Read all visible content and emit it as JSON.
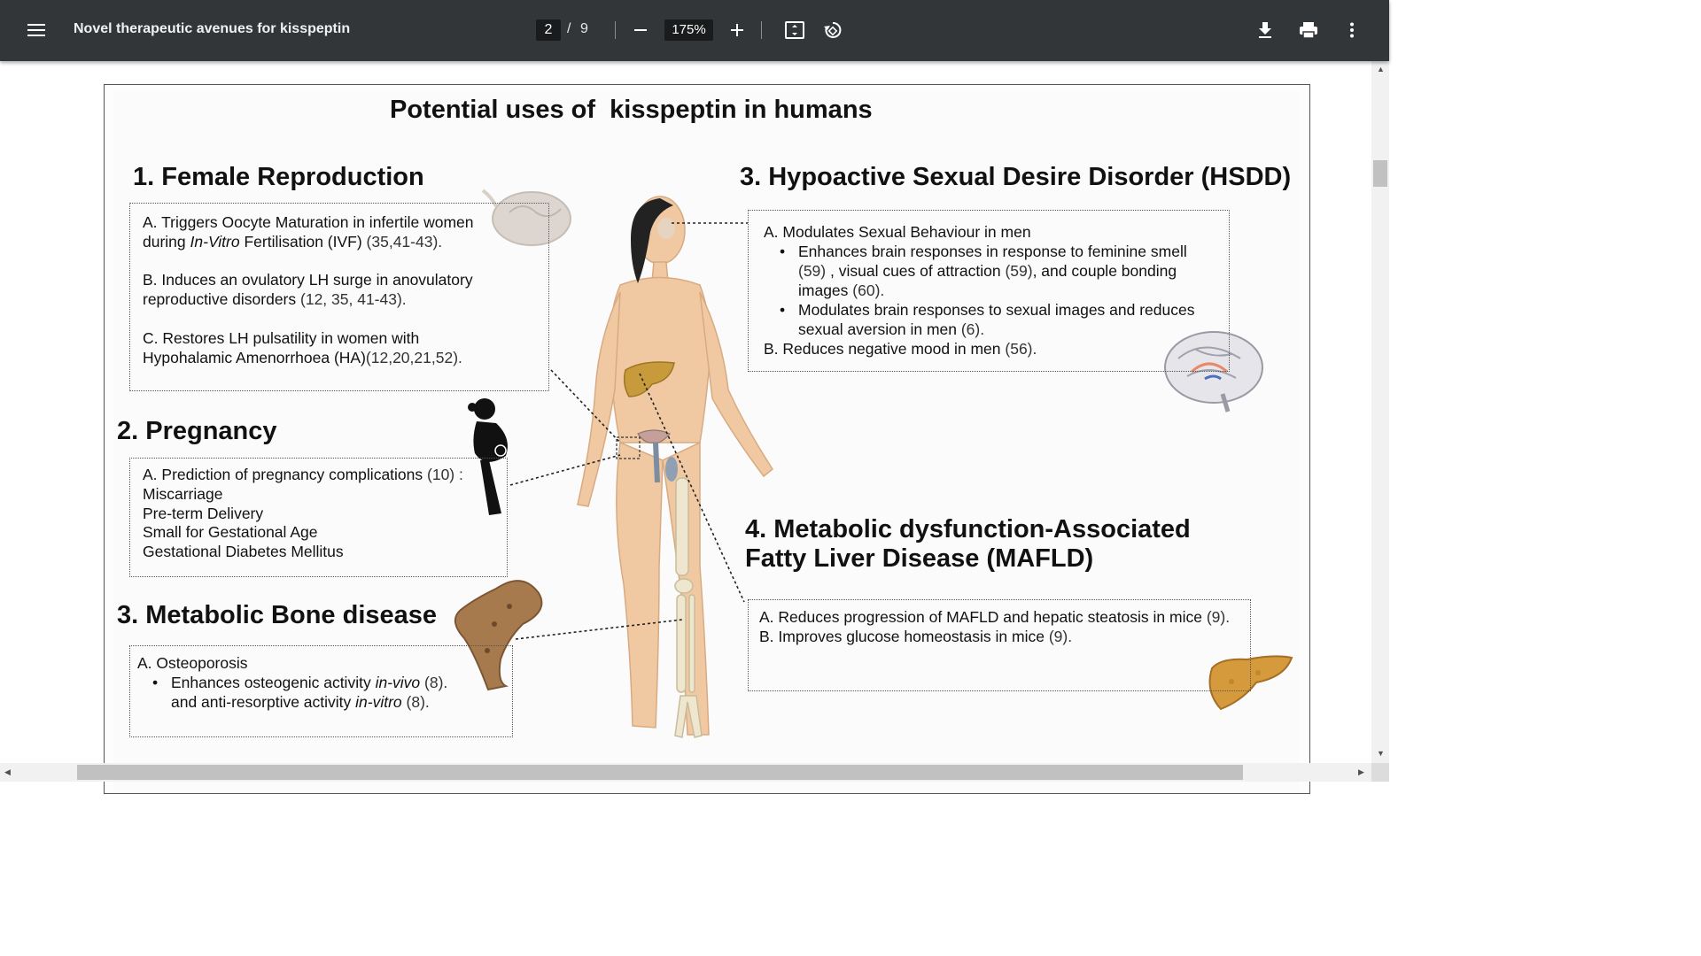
{
  "toolbar": {
    "title": "Novel therapeutic avenues for kisspeptin",
    "current_page": "2",
    "page_separator": "/",
    "total_pages": "9",
    "zoom": "175%"
  },
  "icons": [
    "menu-icon",
    "zoom-out-icon",
    "zoom-in-icon",
    "fit-page-icon",
    "rotate-icon",
    "download-icon",
    "print-icon",
    "more-icon"
  ],
  "figure": {
    "title": "Potential uses of  kisspeptin in humans",
    "s1": {
      "heading": "1.  Female Reproduction",
      "a1": "A. Triggers Oocyte Maturation in infertile women",
      "a2_pre": "during ",
      "a2_it": "In-Vitro",
      "a2_post": " Fertilisation (IVF)",
      "a2_ref": " (35,41-43).",
      "b1": "B. Induces an ovulatory LH surge in anovulatory",
      "b2": "reproductive disorders",
      "b2_ref": " (12, 35, 41-43).",
      "c1": "C. Restores LH pulsatility in women with",
      "c2": "Hypohalamic Amenorrhoea (HA)",
      "c2_ref": "(12,20,21,52)."
    },
    "s2": {
      "heading": "2. Pregnancy",
      "a": "A. Prediction of pregnancy complications",
      "a_ref": " (10) :",
      "items": [
        "Miscarriage",
        "Pre-term Delivery",
        "Small for Gestational Age",
        "Gestational Diabetes Mellitus"
      ]
    },
    "s3bone": {
      "heading": "3. Metabolic Bone disease",
      "a": "A. Osteoporosis",
      "b1_pre": "Enhances osteogenic activity ",
      "b1_it": "in-vivo",
      "b1_ref": " (8).",
      "b2_pre": "and anti-resorptive activity ",
      "b2_it": "in-vitro",
      "b2_ref": " (8)."
    },
    "s3hsdd": {
      "heading": "3. Hypoactive Sexual Desire Disorder (HSDD)",
      "a": "A. Modulates Sexual Behaviour in men",
      "i1_l1": "Enhances brain responses in response to feminine smell",
      "i1_l2_r1": "(59)",
      "i1_l2_t1": " , visual cues of attraction ",
      "i1_l2_r2": "(59)",
      "i1_l2_t2": ", and couple bonding",
      "i1_l3": "images",
      "i1_l3_ref": " (60).",
      "i2_l1": "Modulates brain responses to sexual images and reduces",
      "i2_l2": "sexual aversion in men",
      "i2_l2_ref": " (6).",
      "b": "B. Reduces negative mood in men",
      "b_ref": " (56)."
    },
    "s4": {
      "heading1": "4. Metabolic dysfunction-Associated",
      "heading2": "Fatty Liver Disease (MAFLD)",
      "a": "A. Reduces progression of MAFLD and hepatic steatosis in mice",
      "a_ref": " (9).",
      "b": "B. Improves glucose homeostasis in mice",
      "b_ref": " (9)."
    }
  }
}
